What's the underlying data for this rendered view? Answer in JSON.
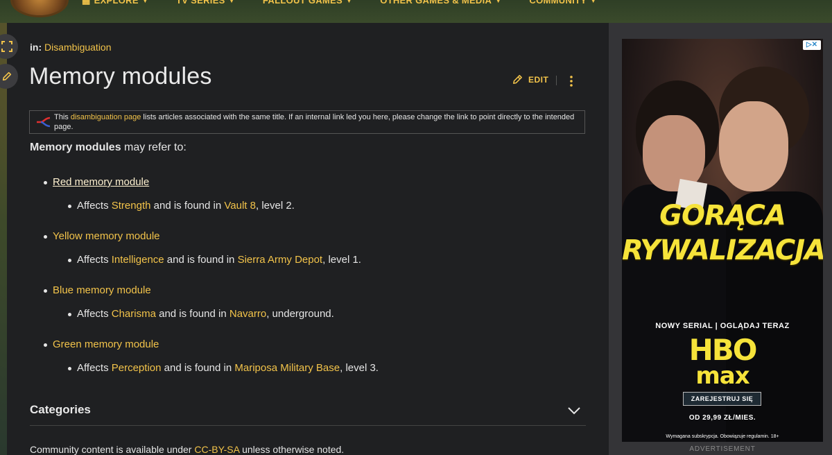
{
  "nav": {
    "items": [
      {
        "label": "Explore"
      },
      {
        "label": "TV Series"
      },
      {
        "label": "Fallout Games"
      },
      {
        "label": "Other Games & Media"
      },
      {
        "label": "Community"
      }
    ]
  },
  "breadcrumb": {
    "prefix": "in:",
    "category": "Disambiguation"
  },
  "page": {
    "title": "Memory modules",
    "edit_label": "EDIT"
  },
  "notice": {
    "text_before": "This ",
    "link": "disambiguation page",
    "text_after": " lists articles associated with the same title. If an internal link led you here, please change the link to point directly to the intended page."
  },
  "intro": {
    "bold": "Memory modules",
    "rest": " may refer to:"
  },
  "entries": [
    {
      "title": "Red memory module",
      "p1": "Affects ",
      "stat": "Strength",
      "p2": " and is found in ",
      "location": "Vault 8",
      "p3": ", level 2."
    },
    {
      "title": "Yellow memory module",
      "p1": "Affects ",
      "stat": "Intelligence",
      "p2": " and is found in ",
      "location": "Sierra Army Depot",
      "p3": ", level 1."
    },
    {
      "title": "Blue memory module",
      "p1": "Affects ",
      "stat": "Charisma",
      "p2": " and is found in ",
      "location": "Navarro",
      "p3": ", underground."
    },
    {
      "title": "Green memory module",
      "p1": "Affects ",
      "stat": "Perception",
      "p2": " and is found in ",
      "location": "Mariposa Military Base",
      "p3": ", level 3."
    }
  ],
  "categories": {
    "heading": "Categories"
  },
  "license": {
    "before": "Community content is available under ",
    "link": "CC-BY-SA",
    "after": " unless otherwise noted."
  },
  "ad": {
    "title_line1": "GORĄCA",
    "title_line2": "RYWALIZACJA",
    "tagline": "NOWY SERIAL | OGLĄDAJ TERAZ",
    "brand_line1": "HBO",
    "brand_line2": "max",
    "cta": "ZAREJESTRUJ SIĘ",
    "price": "OD 29,99 ZŁ/MIES.",
    "fine_print": "Wymagana subskrypcja. Obowiązuje regulamin. 18+",
    "label": "ADVERTISEMENT"
  },
  "colors": {
    "accent": "#f2c34a",
    "panel": "#1f2022",
    "rail": "#343437",
    "ad_yellow": "#f6e33a"
  }
}
